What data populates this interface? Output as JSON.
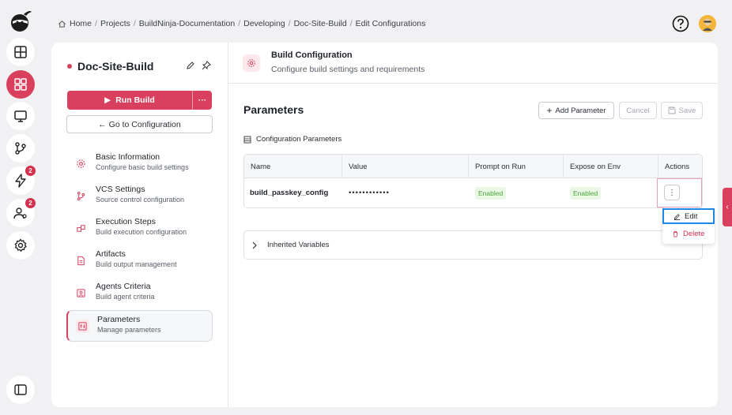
{
  "breadcrumb": {
    "items": [
      "Home",
      "Projects",
      "BuildNinja-Documentation",
      "Developing",
      "Doc-Site-Build",
      "Edit Configurations"
    ],
    "separator": "/"
  },
  "rail": {
    "badges": {
      "lightning": "2",
      "users": "2"
    }
  },
  "build": {
    "name": "Doc-Site-Build",
    "run_label": "Run Build",
    "more_label": "···",
    "goto_label": "← Go to Configuration"
  },
  "nav": [
    {
      "title": "Basic Information",
      "sub": "Configure basic build settings"
    },
    {
      "title": "VCS Settings",
      "sub": "Source control configuration"
    },
    {
      "title": "Execution Steps",
      "sub": "Build execution configuration"
    },
    {
      "title": "Artifacts",
      "sub": "Build output management"
    },
    {
      "title": "Agents Criteria",
      "sub": "Build agent criteria"
    },
    {
      "title": "Parameters",
      "sub": "Manage parameters"
    }
  ],
  "header": {
    "title": "Build Configuration",
    "subtitle": "Configure build settings and requirements"
  },
  "params": {
    "title": "Parameters",
    "add_label": "Add Parameter",
    "cancel_label": "Cancel",
    "save_label": "Save",
    "section_label": "Configuration Parameters",
    "columns": [
      "Name",
      "Value",
      "Prompt on Run",
      "Expose on Env",
      "Actions"
    ],
    "rows": [
      {
        "name": "build_passkey_config",
        "value": "••••••••••••",
        "prompt": "Enabled",
        "expose": "Enabled"
      }
    ],
    "inherited_label": "Inherited Variables"
  },
  "menu": {
    "edit_label": "Edit",
    "delete_label": "Delete"
  },
  "colors": {
    "accent": "#d9405d",
    "enabled_text": "#4aa63a",
    "focus_outline": "#1e88e5"
  }
}
